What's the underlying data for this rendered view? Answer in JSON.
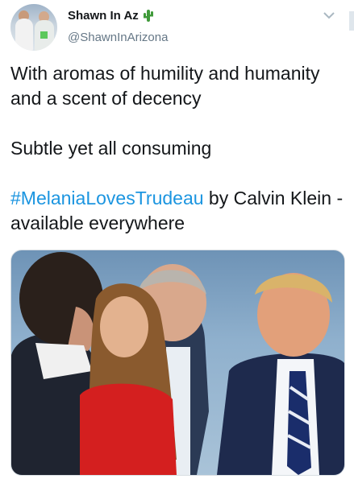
{
  "tweet": {
    "author": {
      "display_name": "Shawn In Az",
      "handle": "@ShawnInArizona",
      "name_emoji_icon": "cactus-icon",
      "avatar_icon": "avatar"
    },
    "menu_icon": "chevron-down-icon",
    "text": {
      "line1": "With aromas of humility and humanity and a scent of decency",
      "line2": "Subtle yet all consuming",
      "hashtag": "#MelaniaLovesTrudeau",
      "line3_rest": " by Calvin Klein - available everywhere"
    },
    "media": {
      "type": "photo"
    },
    "colors": {
      "link": "#1b95e0",
      "secondary_text": "#657786",
      "primary_text": "#14171a"
    }
  }
}
